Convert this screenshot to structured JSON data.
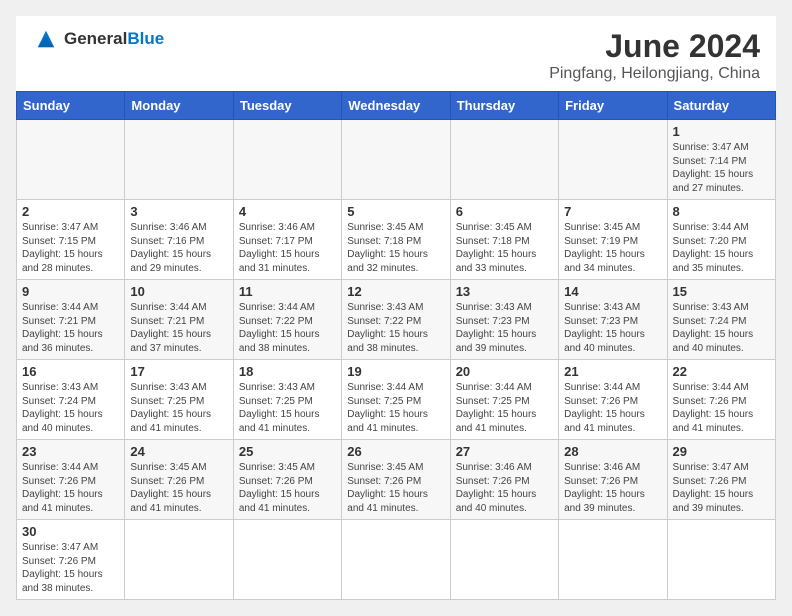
{
  "header": {
    "logo_general": "General",
    "logo_blue": "Blue",
    "title": "June 2024",
    "location": "Pingfang, Heilongjiang, China"
  },
  "weekdays": [
    "Sunday",
    "Monday",
    "Tuesday",
    "Wednesday",
    "Thursday",
    "Friday",
    "Saturday"
  ],
  "weeks": [
    [
      {
        "day": "",
        "info": ""
      },
      {
        "day": "",
        "info": ""
      },
      {
        "day": "",
        "info": ""
      },
      {
        "day": "",
        "info": ""
      },
      {
        "day": "",
        "info": ""
      },
      {
        "day": "",
        "info": ""
      },
      {
        "day": "1",
        "info": "Sunrise: 3:47 AM\nSunset: 7:14 PM\nDaylight: 15 hours\nand 27 minutes."
      }
    ],
    [
      {
        "day": "2",
        "info": "Sunrise: 3:47 AM\nSunset: 7:15 PM\nDaylight: 15 hours\nand 28 minutes."
      },
      {
        "day": "3",
        "info": "Sunrise: 3:46 AM\nSunset: 7:16 PM\nDaylight: 15 hours\nand 29 minutes."
      },
      {
        "day": "4",
        "info": "Sunrise: 3:46 AM\nSunset: 7:17 PM\nDaylight: 15 hours\nand 31 minutes."
      },
      {
        "day": "5",
        "info": "Sunrise: 3:45 AM\nSunset: 7:18 PM\nDaylight: 15 hours\nand 32 minutes."
      },
      {
        "day": "6",
        "info": "Sunrise: 3:45 AM\nSunset: 7:18 PM\nDaylight: 15 hours\nand 33 minutes."
      },
      {
        "day": "7",
        "info": "Sunrise: 3:45 AM\nSunset: 7:19 PM\nDaylight: 15 hours\nand 34 minutes."
      },
      {
        "day": "8",
        "info": "Sunrise: 3:44 AM\nSunset: 7:20 PM\nDaylight: 15 hours\nand 35 minutes."
      }
    ],
    [
      {
        "day": "9",
        "info": "Sunrise: 3:44 AM\nSunset: 7:21 PM\nDaylight: 15 hours\nand 36 minutes."
      },
      {
        "day": "10",
        "info": "Sunrise: 3:44 AM\nSunset: 7:21 PM\nDaylight: 15 hours\nand 37 minutes."
      },
      {
        "day": "11",
        "info": "Sunrise: 3:44 AM\nSunset: 7:22 PM\nDaylight: 15 hours\nand 38 minutes."
      },
      {
        "day": "12",
        "info": "Sunrise: 3:43 AM\nSunset: 7:22 PM\nDaylight: 15 hours\nand 38 minutes."
      },
      {
        "day": "13",
        "info": "Sunrise: 3:43 AM\nSunset: 7:23 PM\nDaylight: 15 hours\nand 39 minutes."
      },
      {
        "day": "14",
        "info": "Sunrise: 3:43 AM\nSunset: 7:23 PM\nDaylight: 15 hours\nand 40 minutes."
      },
      {
        "day": "15",
        "info": "Sunrise: 3:43 AM\nSunset: 7:24 PM\nDaylight: 15 hours\nand 40 minutes."
      }
    ],
    [
      {
        "day": "16",
        "info": "Sunrise: 3:43 AM\nSunset: 7:24 PM\nDaylight: 15 hours\nand 40 minutes."
      },
      {
        "day": "17",
        "info": "Sunrise: 3:43 AM\nSunset: 7:25 PM\nDaylight: 15 hours\nand 41 minutes."
      },
      {
        "day": "18",
        "info": "Sunrise: 3:43 AM\nSunset: 7:25 PM\nDaylight: 15 hours\nand 41 minutes."
      },
      {
        "day": "19",
        "info": "Sunrise: 3:44 AM\nSunset: 7:25 PM\nDaylight: 15 hours\nand 41 minutes."
      },
      {
        "day": "20",
        "info": "Sunrise: 3:44 AM\nSunset: 7:25 PM\nDaylight: 15 hours\nand 41 minutes."
      },
      {
        "day": "21",
        "info": "Sunrise: 3:44 AM\nSunset: 7:26 PM\nDaylight: 15 hours\nand 41 minutes."
      },
      {
        "day": "22",
        "info": "Sunrise: 3:44 AM\nSunset: 7:26 PM\nDaylight: 15 hours\nand 41 minutes."
      }
    ],
    [
      {
        "day": "23",
        "info": "Sunrise: 3:44 AM\nSunset: 7:26 PM\nDaylight: 15 hours\nand 41 minutes."
      },
      {
        "day": "24",
        "info": "Sunrise: 3:45 AM\nSunset: 7:26 PM\nDaylight: 15 hours\nand 41 minutes."
      },
      {
        "day": "25",
        "info": "Sunrise: 3:45 AM\nSunset: 7:26 PM\nDaylight: 15 hours\nand 41 minutes."
      },
      {
        "day": "26",
        "info": "Sunrise: 3:45 AM\nSunset: 7:26 PM\nDaylight: 15 hours\nand 41 minutes."
      },
      {
        "day": "27",
        "info": "Sunrise: 3:46 AM\nSunset: 7:26 PM\nDaylight: 15 hours\nand 40 minutes."
      },
      {
        "day": "28",
        "info": "Sunrise: 3:46 AM\nSunset: 7:26 PM\nDaylight: 15 hours\nand 39 minutes."
      },
      {
        "day": "29",
        "info": "Sunrise: 3:47 AM\nSunset: 7:26 PM\nDaylight: 15 hours\nand 39 minutes."
      }
    ],
    [
      {
        "day": "30",
        "info": "Sunrise: 3:47 AM\nSunset: 7:26 PM\nDaylight: 15 hours\nand 38 minutes."
      },
      {
        "day": "",
        "info": ""
      },
      {
        "day": "",
        "info": ""
      },
      {
        "day": "",
        "info": ""
      },
      {
        "day": "",
        "info": ""
      },
      {
        "day": "",
        "info": ""
      },
      {
        "day": "",
        "info": ""
      }
    ]
  ]
}
